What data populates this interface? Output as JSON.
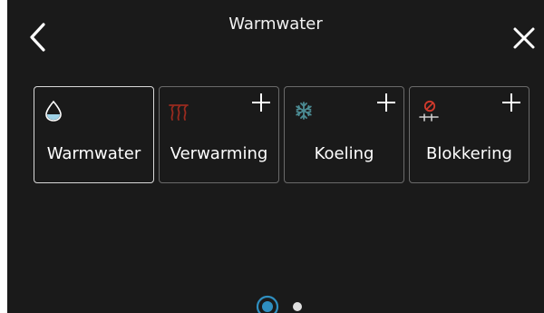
{
  "header": {
    "title": "Warmwater"
  },
  "icons": {
    "back": "chevron-left-icon",
    "close": "close-icon"
  },
  "tiles": [
    {
      "label": "Warmwater",
      "icon": "water-drop-icon",
      "active": true,
      "has_add": false
    },
    {
      "label": "Verwarming",
      "icon": "heating-icon",
      "active": false,
      "has_add": true
    },
    {
      "label": "Koeling",
      "icon": "snowflake-icon",
      "active": false,
      "has_add": true
    },
    {
      "label": "Blokkering",
      "icon": "blocking-icon",
      "active": false,
      "has_add": true
    }
  ],
  "pagination": {
    "current_page": 1,
    "total_pages": 2
  },
  "colors": {
    "background": "#1a1a1a",
    "accent_blue": "#2f8fc0",
    "heating_red": "#9a2b1f",
    "cooling_teal": "#4c8c94",
    "block_red": "#d03a2c",
    "water_light_blue": "#9fd3e8"
  }
}
